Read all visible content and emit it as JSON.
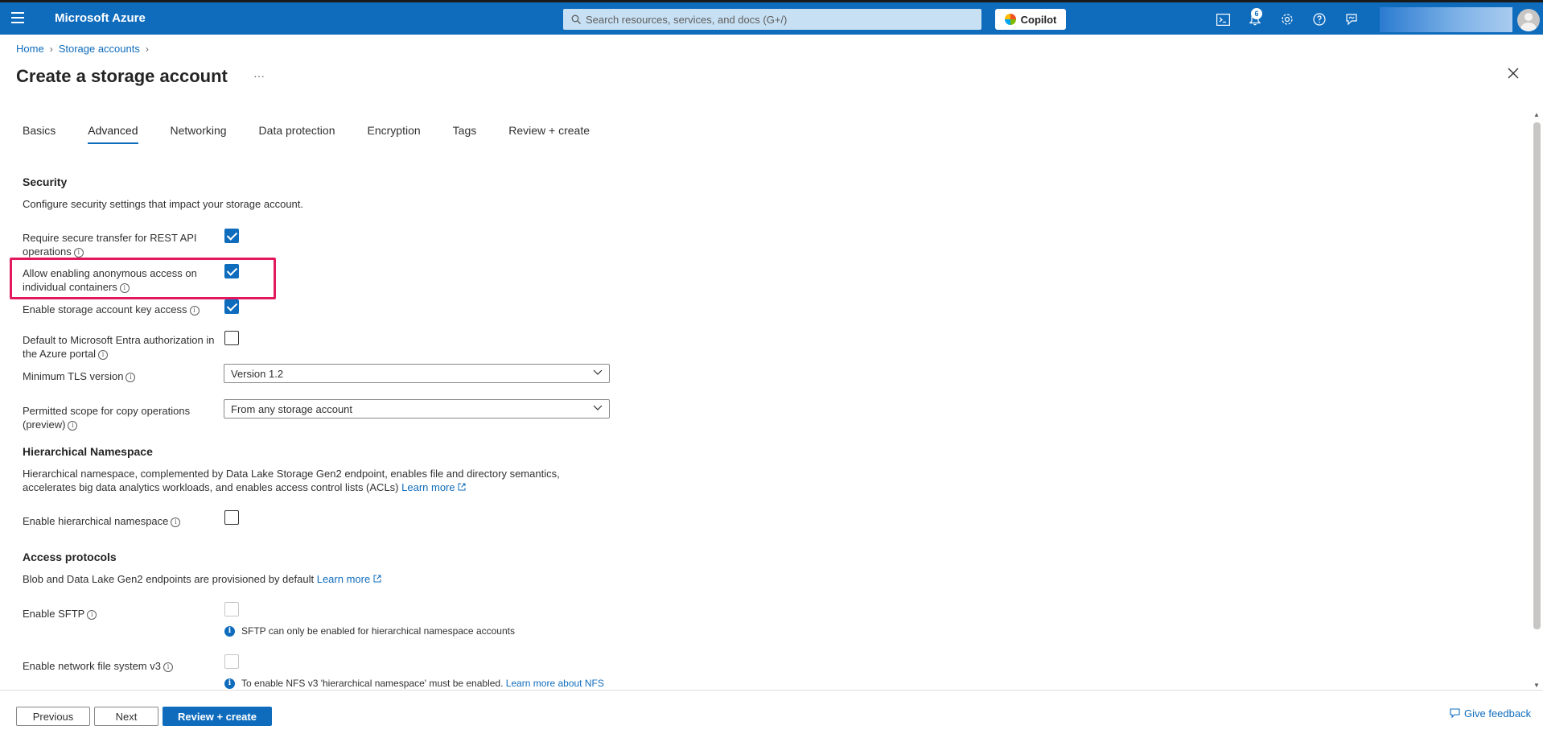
{
  "topbar": {
    "brand": "Microsoft Azure",
    "search_placeholder": "Search resources, services, and docs (G+/)",
    "copilot_label": "Copilot",
    "notification_count": "6"
  },
  "breadcrumb": {
    "home": "Home",
    "storage_accounts": "Storage accounts"
  },
  "page": {
    "title": "Create a storage account",
    "more": "···"
  },
  "tabs": [
    {
      "label": "Basics",
      "active": false
    },
    {
      "label": "Advanced",
      "active": true
    },
    {
      "label": "Networking",
      "active": false
    },
    {
      "label": "Data protection",
      "active": false
    },
    {
      "label": "Encryption",
      "active": false
    },
    {
      "label": "Tags",
      "active": false
    },
    {
      "label": "Review + create",
      "active": false
    }
  ],
  "security": {
    "title": "Security",
    "description": "Configure security settings that impact your storage account.",
    "require_secure_transfer": {
      "label": "Require secure transfer for REST API operations",
      "checked": true
    },
    "anonymous_access": {
      "label": "Allow enabling anonymous access on individual containers",
      "checked": true
    },
    "key_access": {
      "label": "Enable storage account key access",
      "checked": true
    },
    "entra_default": {
      "label": "Default to Microsoft Entra authorization in the Azure portal",
      "checked": false
    },
    "min_tls": {
      "label": "Minimum TLS version",
      "value": "Version 1.2"
    },
    "copy_scope": {
      "label": "Permitted scope for copy operations (preview)",
      "value": "From any storage account"
    }
  },
  "hierarchical": {
    "title": "Hierarchical Namespace",
    "description": "Hierarchical namespace, complemented by Data Lake Storage Gen2 endpoint, enables file and directory semantics, accelerates big data analytics workloads, and enables access control lists (ACLs)",
    "learn_more": "Learn more",
    "enable": {
      "label": "Enable hierarchical namespace",
      "checked": false
    }
  },
  "access_protocols": {
    "title": "Access protocols",
    "description": "Blob and Data Lake Gen2 endpoints are provisioned by default",
    "learn_more": "Learn more",
    "sftp": {
      "label": "Enable SFTP",
      "note": "SFTP can only be enabled for hierarchical namespace accounts"
    },
    "nfs": {
      "label": "Enable network file system v3",
      "note": "To enable NFS v3 'hierarchical namespace' must be enabled.",
      "note_link": "Learn more about NFS"
    }
  },
  "footer": {
    "previous": "Previous",
    "next": "Next",
    "review_create": "Review + create",
    "feedback": "Give feedback"
  },
  "colors": {
    "azure_blue": "#0f6cbd",
    "highlight": "#e3195e"
  }
}
